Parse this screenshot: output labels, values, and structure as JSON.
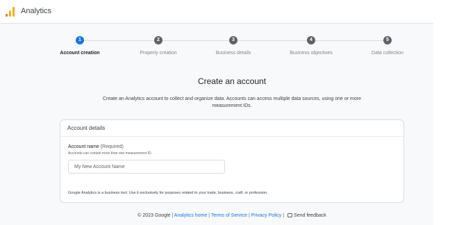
{
  "header": {
    "app_title": "Analytics"
  },
  "stepper": {
    "active_index": 0,
    "steps": [
      {
        "number": "1",
        "label": "Account creation"
      },
      {
        "number": "2",
        "label": "Property creation"
      },
      {
        "number": "3",
        "label": "Business details"
      },
      {
        "number": "4",
        "label": "Business objectives"
      },
      {
        "number": "5",
        "label": "Data collection"
      }
    ]
  },
  "main": {
    "heading": "Create an account",
    "intro": "Create an Analytics account to collect and organize data. Accounts can access multiple data sources, using one or more measurement IDs."
  },
  "card": {
    "title": "Account details",
    "account_name_label": "Account name",
    "required_text": "(Required)",
    "account_name_hint": "Accounts can contain more than one measurement ID.",
    "account_name_value": "",
    "account_name_placeholder": "My New Account Name",
    "disclaimer": "Google Analytics is a business tool. Use it exclusively for purposes related to your trade, business, craft, or profession."
  },
  "footer": {
    "copyright": "© 2023 Google",
    "separator": "|",
    "analytics_home": "Analytics home",
    "terms": "Terms of Service",
    "privacy": "Privacy Policy",
    "feedback": "Send feedback"
  },
  "colors": {
    "accent": "#1a73e8",
    "inactive_step": "#5f6368",
    "logo_orange": "#f9ab00",
    "logo_dark_orange": "#e37400"
  },
  "icons": [
    "analytics-logo-icon",
    "feedback-icon"
  ]
}
